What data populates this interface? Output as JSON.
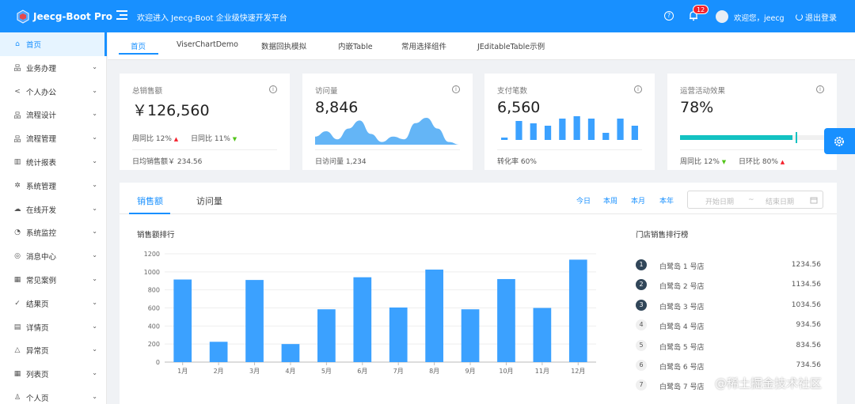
{
  "header": {
    "app_name": "Jeecg-Boot Pro",
    "welcome_text": "欢迎进入 Jeecg-Boot 企业级快速开发平台",
    "notification_count": "12",
    "user_greeting": "欢迎您，jeecg",
    "logout_label": "退出登录",
    "accent_color": "#1890ff"
  },
  "sidebar": {
    "items": [
      {
        "label": "首页",
        "icon": "home-icon",
        "active": true
      },
      {
        "label": "业务办理",
        "icon": "org-icon"
      },
      {
        "label": "个人办公",
        "icon": "share-icon"
      },
      {
        "label": "流程设计",
        "icon": "org-icon"
      },
      {
        "label": "流程管理",
        "icon": "org-icon"
      },
      {
        "label": "统计报表",
        "icon": "bar-chart-icon"
      },
      {
        "label": "系统管理",
        "icon": "gear-icon"
      },
      {
        "label": "在线开发",
        "icon": "cloud-icon"
      },
      {
        "label": "系统监控",
        "icon": "dashboard-icon"
      },
      {
        "label": "消息中心",
        "icon": "message-icon"
      },
      {
        "label": "常见案例",
        "icon": "grid-icon"
      },
      {
        "label": "结果页",
        "icon": "check-circle-icon"
      },
      {
        "label": "详情页",
        "icon": "profile-icon"
      },
      {
        "label": "异常页",
        "icon": "warning-icon"
      },
      {
        "label": "列表页",
        "icon": "table-icon"
      },
      {
        "label": "个人页",
        "icon": "user-icon"
      }
    ]
  },
  "tabs": [
    "首页",
    "ViserChartDemo",
    "数据回执模拟",
    "内嵌Table",
    "常用选择组件",
    "JEditableTable示例"
  ],
  "cards": {
    "sales": {
      "title": "总销售额",
      "value": "￥126,560",
      "wow_label": "周同比",
      "wow_value": "12%",
      "dod_label": "日同比",
      "dod_value": "11%",
      "footer": "日均销售额￥ 234.56"
    },
    "visits": {
      "title": "访问量",
      "value": "8,846",
      "footer": "日访问量 1,234"
    },
    "payments": {
      "title": "支付笔数",
      "value": "6,560",
      "footer": "转化率 60%"
    },
    "campaign": {
      "title": "运营活动效果",
      "value": "78%",
      "progress": 78,
      "wow_label": "周同比",
      "wow_value": "12%",
      "dod_label": "日环比",
      "dod_value": "80%"
    }
  },
  "panel": {
    "tabs": [
      "销售额",
      "访问量"
    ],
    "quick_ranges": [
      "今日",
      "本周",
      "本月",
      "本年"
    ],
    "start_placeholder": "开始日期",
    "range_separator": "~",
    "end_placeholder": "结束日期",
    "chart_title": "销售额排行",
    "ranking_title": "门店销售排行榜",
    "ranking": [
      {
        "rank": "1",
        "name": "白鹭岛 1 号店",
        "value": "1234.56"
      },
      {
        "rank": "2",
        "name": "白鹭岛 2 号店",
        "value": "1134.56"
      },
      {
        "rank": "3",
        "name": "白鹭岛 3 号店",
        "value": "1034.56"
      },
      {
        "rank": "4",
        "name": "白鹭岛 4 号店",
        "value": "934.56"
      },
      {
        "rank": "5",
        "name": "白鹭岛 5 号店",
        "value": "834.56"
      },
      {
        "rank": "6",
        "name": "白鹭岛 6 号店",
        "value": "734.56"
      },
      {
        "rank": "7",
        "name": "白鹭岛 7 号店",
        "value": ""
      }
    ]
  },
  "watermark": "@稀土掘金技术社区",
  "chart_data": {
    "type": "bar",
    "categories": [
      "1月",
      "2月",
      "3月",
      "4月",
      "5月",
      "6月",
      "7月",
      "8月",
      "9月",
      "10月",
      "11月",
      "12月"
    ],
    "values": [
      915,
      225,
      910,
      200,
      585,
      940,
      605,
      1025,
      585,
      920,
      600,
      1135
    ],
    "ylim": [
      0,
      1200
    ],
    "yticks": [
      "0",
      "200",
      "400",
      "600",
      "800",
      "1000",
      "1200"
    ],
    "color": "#3ba1ff",
    "grid": true
  },
  "mini_charts": {
    "visits_area": [
      3,
      5,
      2,
      6,
      9,
      4,
      1,
      3,
      2,
      8,
      10,
      6,
      1,
      0
    ],
    "payments_bars": [
      1,
      8,
      7,
      6,
      9,
      10,
      9,
      3,
      9,
      6
    ],
    "color": "#3ba1ff"
  }
}
